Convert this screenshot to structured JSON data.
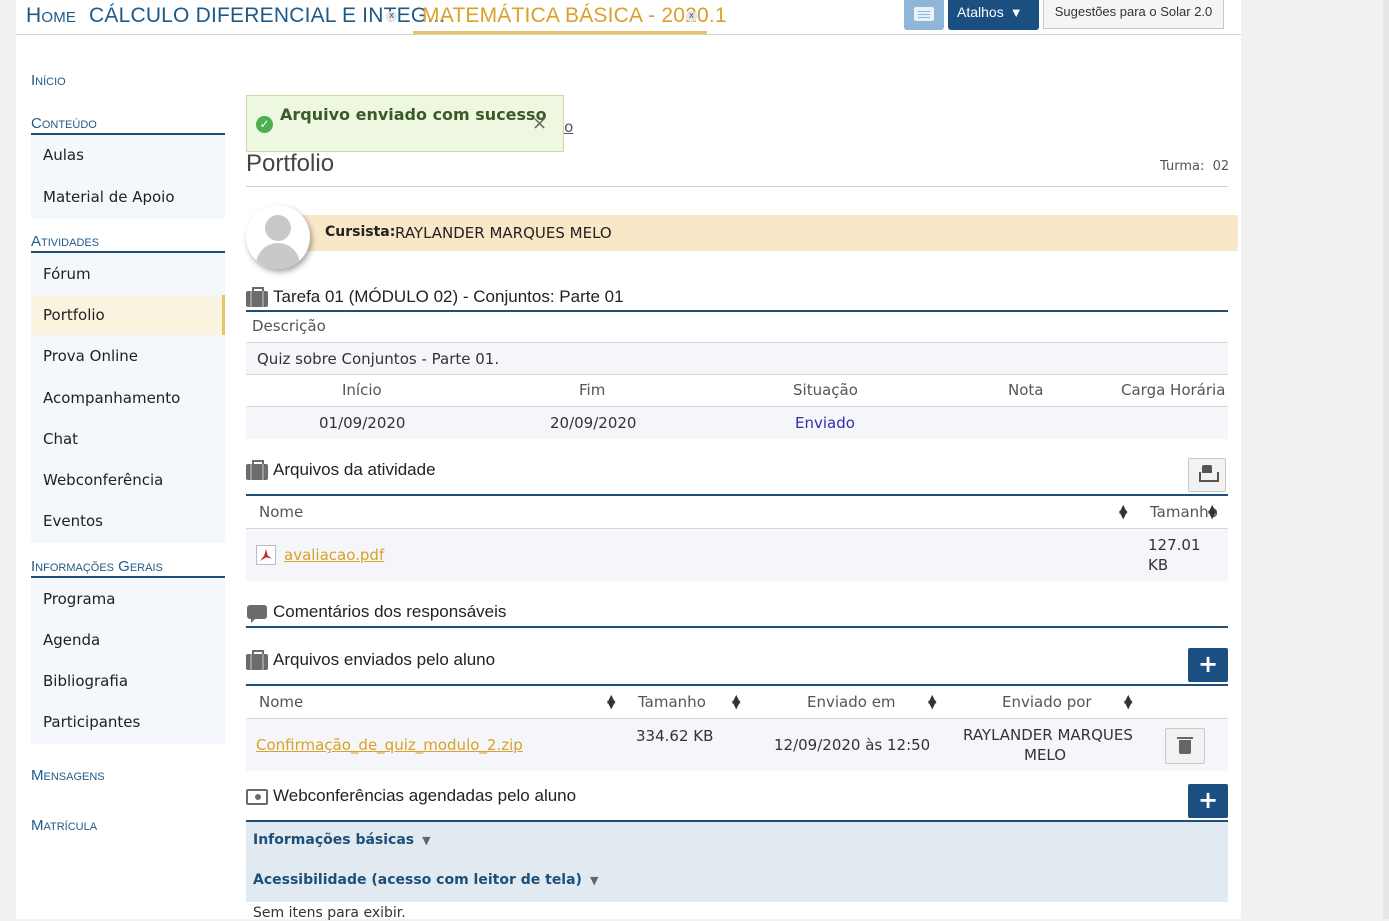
{
  "topbar": {
    "home": "Home",
    "tab_calc": "CÁLCULO DIFERENCIAL E INTEG...",
    "tab_mat": "MATEMÁTICA BÁSICA - 2020.1",
    "close_glyph": "x",
    "atalhos": "Atalhos",
    "sugestoes": "Sugestões para o Solar 2.0"
  },
  "sidebar": {
    "inicio": "Início",
    "conteudo": "Conteúdo",
    "conteudo_items": [
      "Aulas",
      "Material de Apoio"
    ],
    "atividades": "Atividades",
    "atividades_items": [
      "Fórum",
      "Portfolio",
      "Prova Online",
      "Acompanhamento",
      "Chat",
      "Webconferência",
      "Eventos"
    ],
    "info": "Informações Gerais",
    "info_items": [
      "Programa",
      "Agenda",
      "Bibliografia",
      "Participantes"
    ],
    "mensagens": "Mensagens",
    "matricula": "Matrícula"
  },
  "toast": {
    "message": "Arquivo enviado com sucesso",
    "close": "×"
  },
  "breadcrumb_tail": "io",
  "page": {
    "title": "Portfolio",
    "turma_label": "Turma:",
    "turma_value": "02"
  },
  "student": {
    "label": "Cursista:",
    "name": "RAYLANDER MARQUES MELO"
  },
  "task": {
    "title": "Tarefa 01 (MÓDULO 02) - Conjuntos: Parte 01",
    "desc_label": "Descrição",
    "desc": "Quiz sobre Conjuntos - Parte 01.",
    "headers": [
      "Início",
      "Fim",
      "Situação",
      "Nota",
      "Carga Horária"
    ],
    "inicio": "01/09/2020",
    "fim": "20/09/2020",
    "situacao": "Enviado",
    "nota": "",
    "carga": ""
  },
  "activity_files": {
    "title": "Arquivos da atividade",
    "col_name": "Nome",
    "col_size": "Tamanho",
    "file_name": "avaliacao.pdf",
    "file_size_1": "127.01",
    "file_size_2": "KB"
  },
  "comments": {
    "title": "Comentários dos responsáveis"
  },
  "student_files": {
    "title": "Arquivos enviados pelo aluno",
    "col_name": "Nome",
    "col_size": "Tamanho",
    "col_sent": "Enviado em",
    "col_by": "Enviado por",
    "file_name": "Confirmação_de_quiz_modulo_2.zip",
    "file_size": "334.62 KB",
    "sent_at": "12/09/2020 às 12:50",
    "sent_by_1": "RAYLANDER MARQUES",
    "sent_by_2": "MELO",
    "add": "+"
  },
  "webconf": {
    "title": "Webconferências agendadas pelo aluno",
    "add": "+",
    "basic": "Informações básicas",
    "access": "Acessibilidade (acesso com leitor de tela)",
    "empty": "Sem itens para exibir."
  },
  "colors": {
    "accent": "#1b4f82",
    "gold": "#d9a12a",
    "student_bar": "#f9e8c8"
  },
  "icons": [
    "close-icon",
    "chat-icon",
    "caret-down-icon",
    "success-icon",
    "avatar-icon",
    "briefcase-icon",
    "download-tray-icon",
    "sort-icon",
    "pdf-icon",
    "comment-icon",
    "plus-icon",
    "trash-icon",
    "screen-icon"
  ]
}
